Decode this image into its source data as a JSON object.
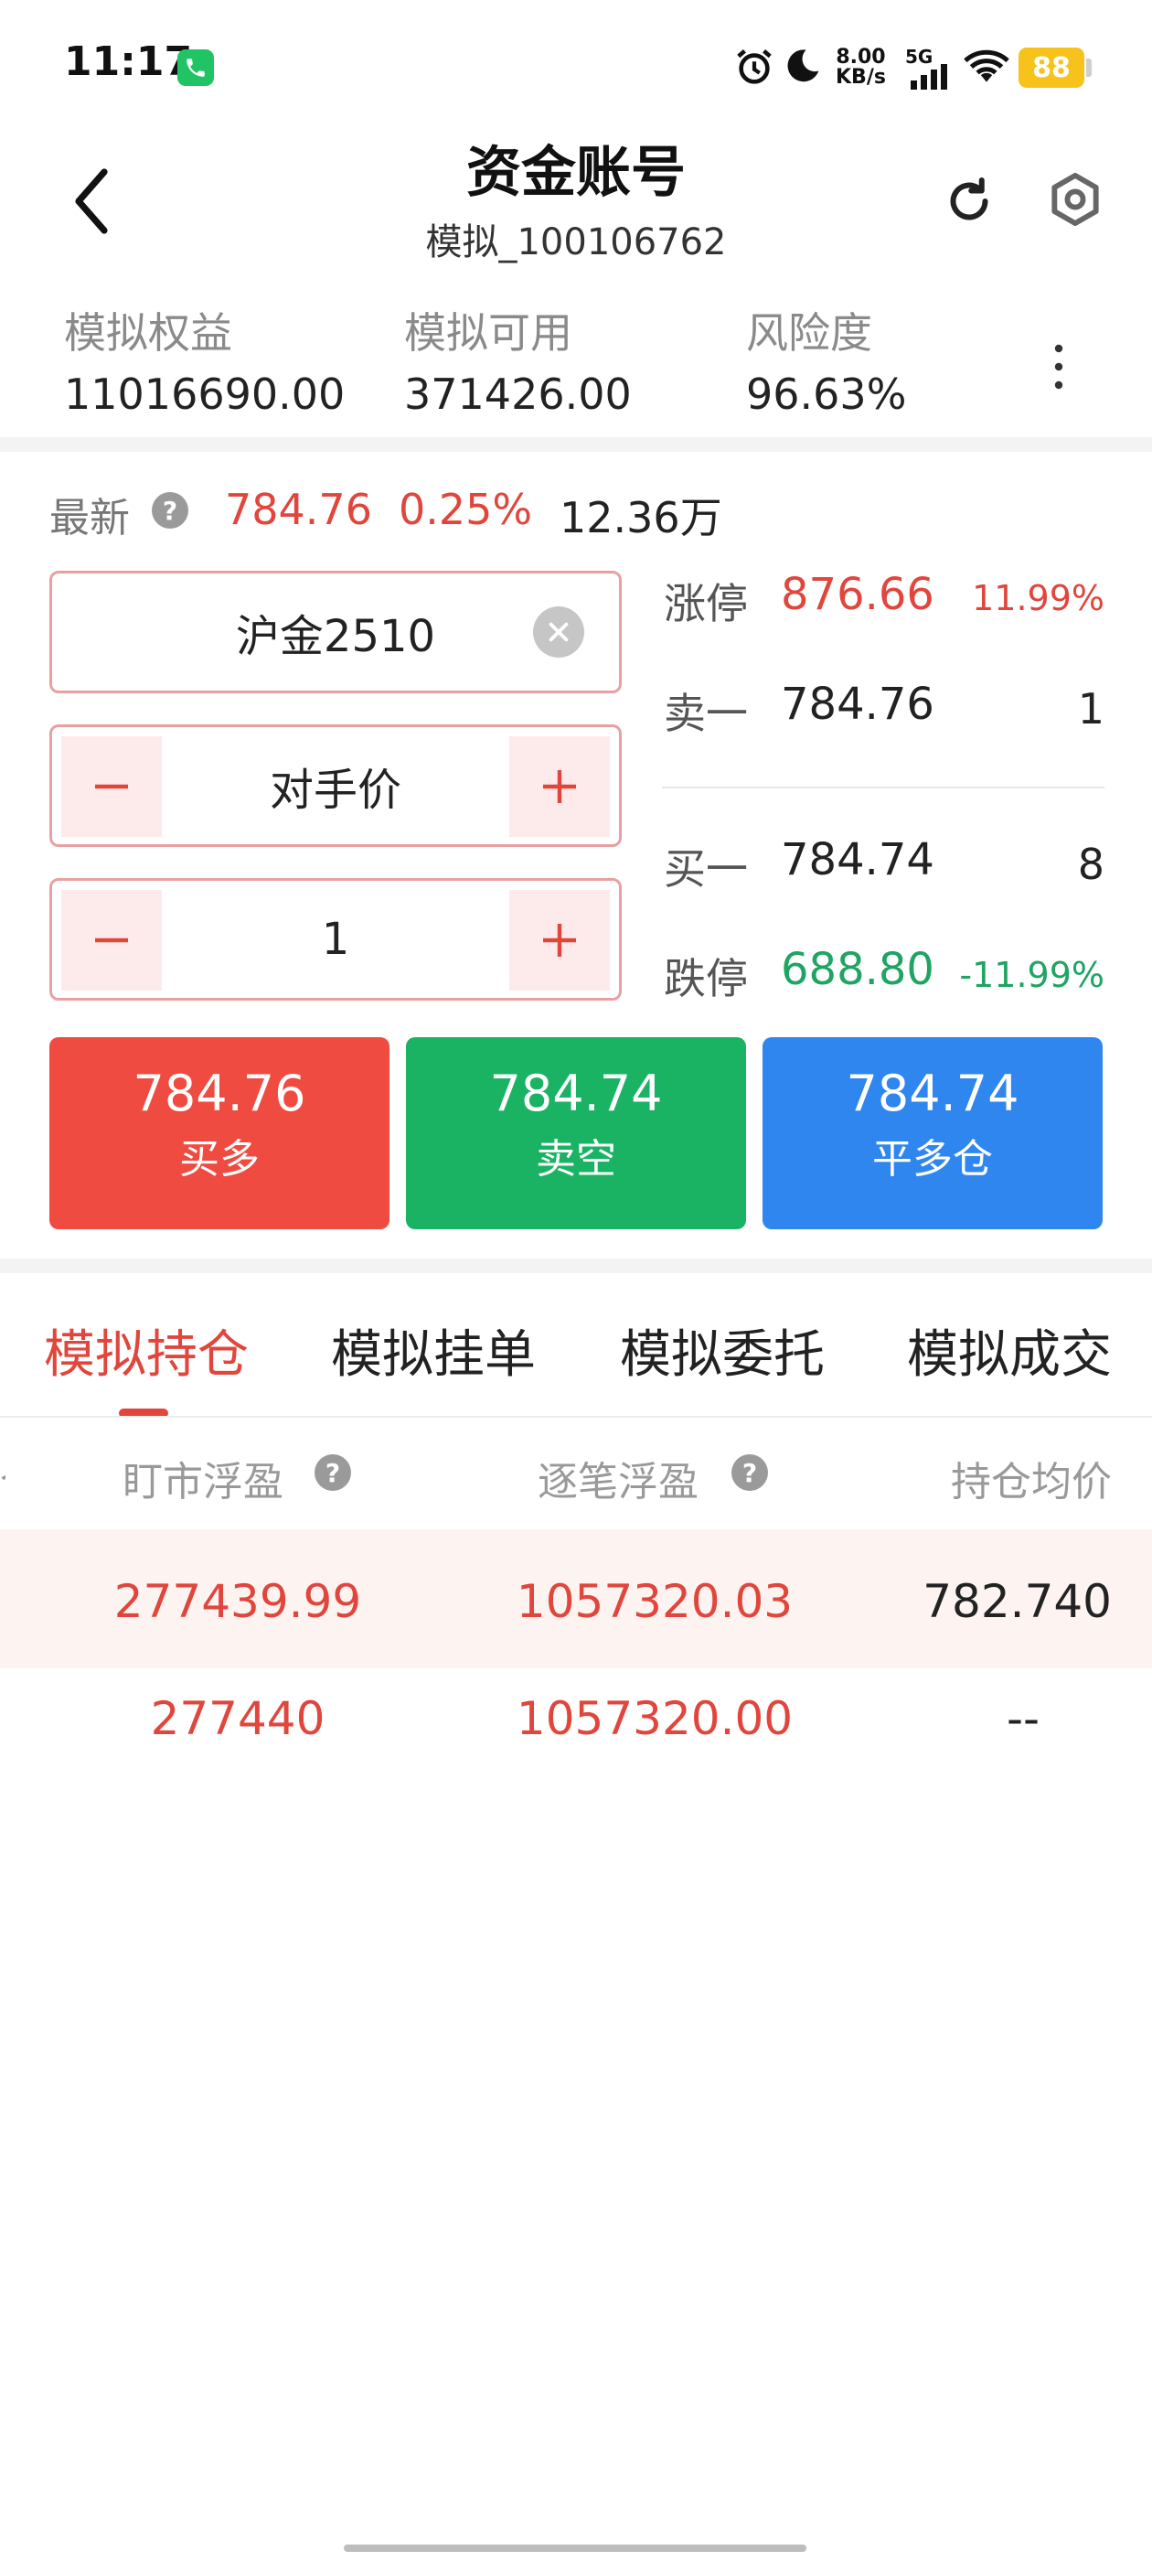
{
  "status_bar": {
    "time": "11:17",
    "net_speed_value": "8.00",
    "net_speed_unit": "KB/s",
    "signal_label": "5G",
    "battery": "88"
  },
  "header": {
    "title": "资金账号",
    "subtitle": "模拟_100106762"
  },
  "account": {
    "equity_label": "模拟权益",
    "equity_value": "11016690.00",
    "available_label": "模拟可用",
    "available_value": "371426.00",
    "risk_label": "风险度",
    "risk_value": "96.63%"
  },
  "quote": {
    "latest_label": "最新",
    "help_glyph": "?",
    "last_price": "784.76",
    "change_pct": "0.25%",
    "volume": "12.36万"
  },
  "order_form": {
    "contract": "沪金2510",
    "price_type": "对手价",
    "quantity": "1"
  },
  "order_book": {
    "limit_up_label": "涨停",
    "limit_up_price": "876.66",
    "limit_up_pct": "11.99%",
    "ask1_label": "卖一",
    "ask1_price": "784.76",
    "ask1_qty": "1",
    "bid1_label": "买一",
    "bid1_price": "784.74",
    "bid1_qty": "8",
    "limit_down_label": "跌停",
    "limit_down_price": "688.80",
    "limit_down_pct": "-11.99%"
  },
  "trade_buttons": {
    "buy_long_price": "784.76",
    "buy_long_label": "买多",
    "sell_short_price": "784.74",
    "sell_short_label": "卖空",
    "close_long_price": "784.74",
    "close_long_label": "平多仓"
  },
  "tabs": [
    "模拟持仓",
    "模拟挂单",
    "模拟委托",
    "模拟成交"
  ],
  "positions": {
    "headers": [
      "盯市浮盈",
      "逐笔浮盈",
      "持仓均价"
    ],
    "rows": [
      [
        "277439.99",
        "1057320.03",
        "782.740"
      ],
      [
        "277440",
        "1057320.00",
        "--"
      ]
    ]
  },
  "colors": {
    "buy_red": "#f04b41",
    "sell_green": "#1ab364",
    "close_blue": "#2f86ee",
    "accent_red": "#e0463c"
  }
}
